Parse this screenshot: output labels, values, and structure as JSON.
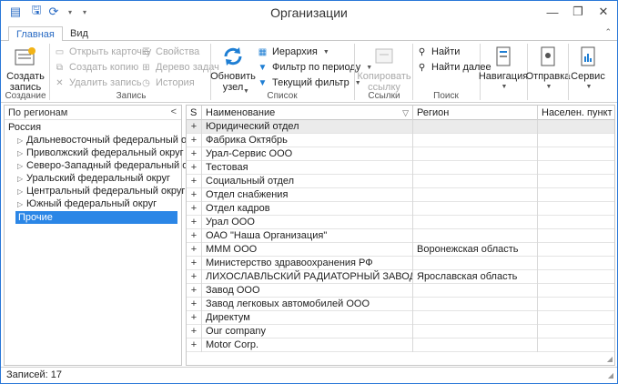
{
  "window": {
    "title": "Организации",
    "minimize_glyph": "—",
    "restore_glyph": "❐",
    "close_glyph": "✕"
  },
  "quick_access": {
    "icons": [
      "grid-icon",
      "save-icon",
      "refresh-icon",
      "dropdown-icon"
    ]
  },
  "tabs": [
    {
      "label": "Главная",
      "active": true
    },
    {
      "label": "Вид",
      "active": false
    }
  ],
  "ribbon": {
    "groups": {
      "create": {
        "label": "Создание",
        "button": "Создать\nзапись"
      },
      "record": {
        "label": "Запись",
        "open_card": "Открыть карточку",
        "create_copy": "Создать копию",
        "delete_record": "Удалить запись",
        "properties": "Свойства",
        "task_tree": "Дерево задач",
        "history": "История"
      },
      "list": {
        "label": "Список",
        "refresh_node": "Обновить\nузел",
        "hierarchy": "Иерархия",
        "period_filter": "Фильтр по периоду",
        "current_filter": "Текущий фильтр"
      },
      "links": {
        "label": "Ссылки",
        "copy_link": "Копировать\nссылку"
      },
      "search": {
        "label": "Поиск",
        "find": "Найти",
        "find_next": "Найти далее"
      },
      "navigation": {
        "label": "Навигация"
      },
      "sending": {
        "label": "Отправка"
      },
      "service": {
        "label": "Сервис"
      }
    }
  },
  "left_panel": {
    "header": "По регионам",
    "collapse_glyph": "<",
    "root": "Россия",
    "items": [
      "Дальневосточный федеральный округ",
      "Приволжский федеральный округ",
      "Северо-Западный федеральный округ",
      "Уральский федеральный округ",
      "Центральный федеральный округ",
      "Южный федеральный округ"
    ],
    "selected": "Прочие"
  },
  "grid": {
    "columns": [
      "S",
      "Наименование",
      "Регион",
      "Населен. пункт"
    ],
    "expand_glyph": "+",
    "rows": [
      {
        "name": "Юридический отдел",
        "region": "",
        "settlement": ""
      },
      {
        "name": "Фабрика Октябрь",
        "region": "",
        "settlement": ""
      },
      {
        "name": "Урал-Сервис ООО",
        "region": "",
        "settlement": ""
      },
      {
        "name": "Тестовая",
        "region": "",
        "settlement": ""
      },
      {
        "name": "Социальный отдел",
        "region": "",
        "settlement": ""
      },
      {
        "name": "Отдел снабжения",
        "region": "",
        "settlement": ""
      },
      {
        "name": "Отдел кадров",
        "region": "",
        "settlement": ""
      },
      {
        "name": "Урал ООО",
        "region": "",
        "settlement": ""
      },
      {
        "name": "ОАО \"Наша Организация\"",
        "region": "",
        "settlement": ""
      },
      {
        "name": "МММ ООО",
        "region": "Воронежская область",
        "settlement": ""
      },
      {
        "name": "Министерство здравоохранения РФ",
        "region": "",
        "settlement": ""
      },
      {
        "name": "ЛИХОСЛАВЛЬСКИЙ РАДИАТОРНЫЙ ЗАВОД ОАО",
        "region": "Ярославская область",
        "settlement": ""
      },
      {
        "name": "Завод ООО",
        "region": "",
        "settlement": ""
      },
      {
        "name": "Завод легковых автомобилей ООО",
        "region": "",
        "settlement": ""
      },
      {
        "name": "Директум",
        "region": "",
        "settlement": ""
      },
      {
        "name": "Our company",
        "region": "",
        "settlement": ""
      },
      {
        "name": "Motor Corp.",
        "region": "",
        "settlement": ""
      }
    ]
  },
  "status": {
    "records": "Записей: 17"
  }
}
